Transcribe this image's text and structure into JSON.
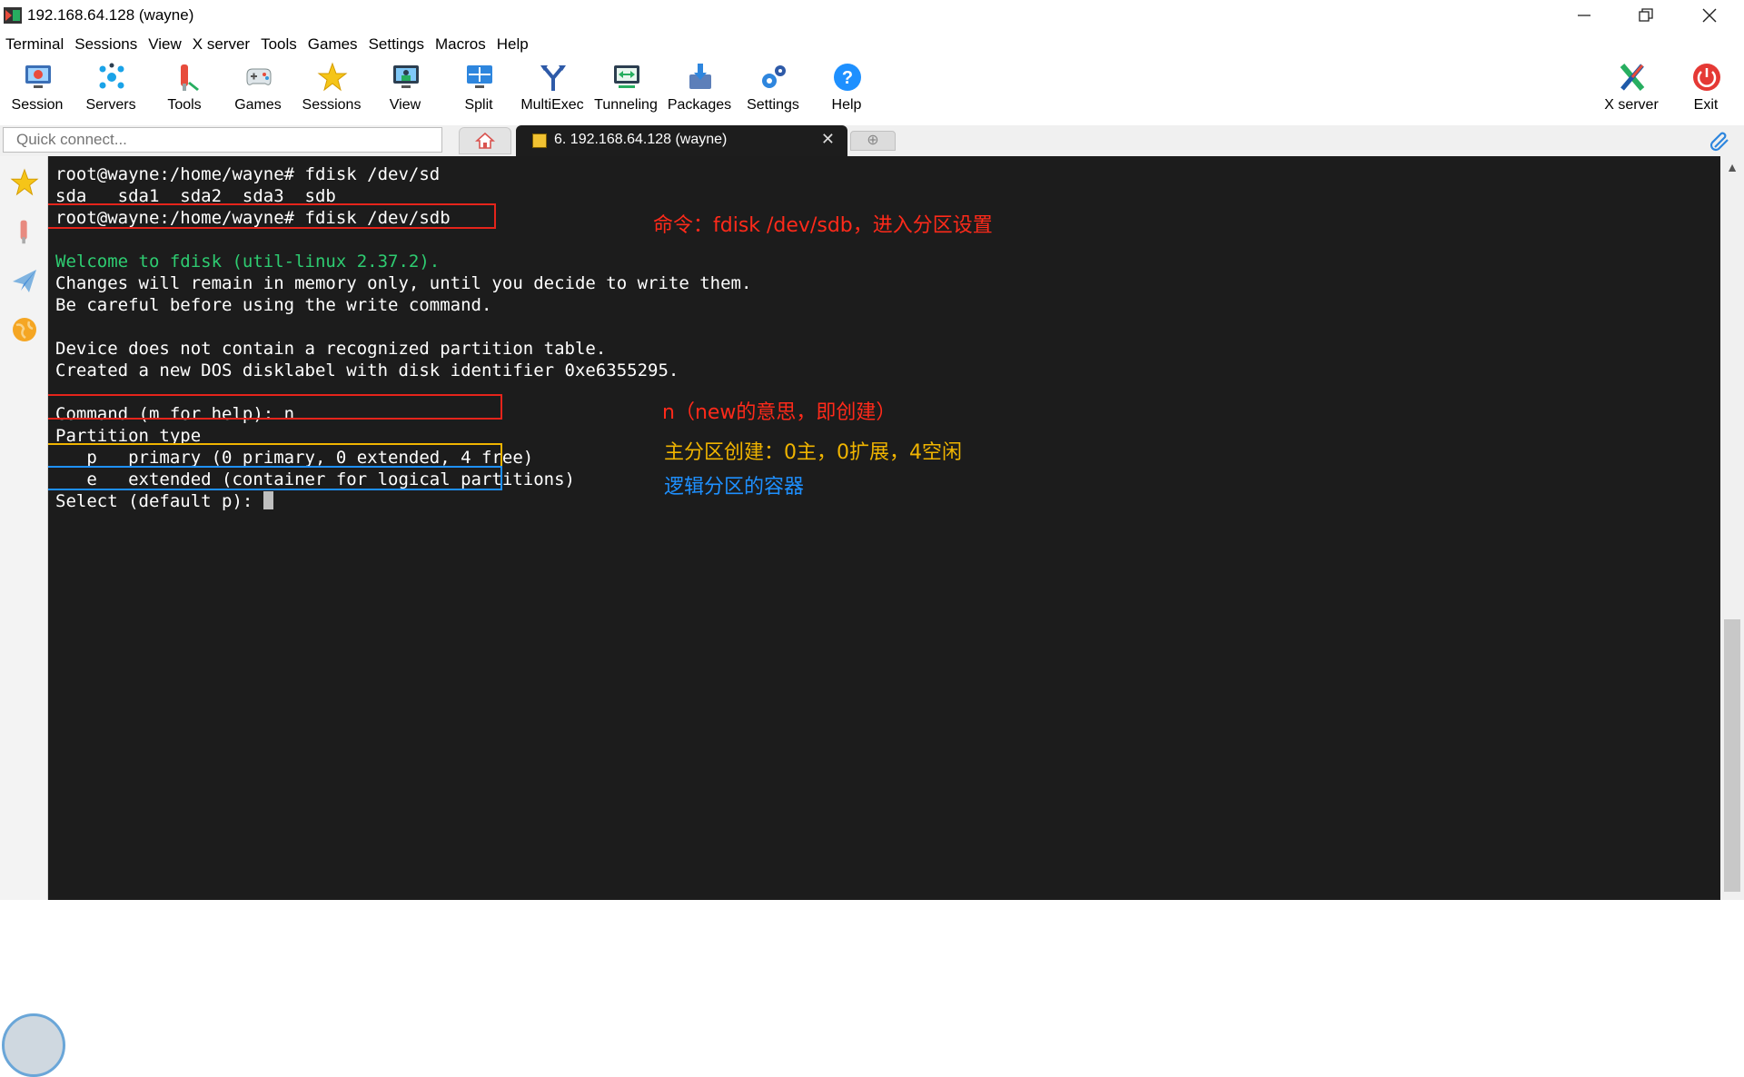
{
  "window": {
    "title": "192.168.64.128 (wayne)",
    "controls": [
      "minimize",
      "restore",
      "close"
    ]
  },
  "menu": [
    "Terminal",
    "Sessions",
    "View",
    "X server",
    "Tools",
    "Games",
    "Settings",
    "Macros",
    "Help"
  ],
  "toolbar": {
    "items": [
      {
        "label": "Session",
        "icon": "session-icon"
      },
      {
        "label": "Servers",
        "icon": "servers-icon"
      },
      {
        "label": "Tools",
        "icon": "tools-icon"
      },
      {
        "label": "Games",
        "icon": "games-icon"
      },
      {
        "label": "Sessions",
        "icon": "star-icon"
      },
      {
        "label": "View",
        "icon": "view-icon"
      },
      {
        "label": "Split",
        "icon": "split-icon"
      },
      {
        "label": "MultiExec",
        "icon": "multiexec-icon"
      },
      {
        "label": "Tunneling",
        "icon": "tunneling-icon"
      },
      {
        "label": "Packages",
        "icon": "packages-icon"
      },
      {
        "label": "Settings",
        "icon": "settings-icon"
      },
      {
        "label": "Help",
        "icon": "help-icon"
      }
    ],
    "right": [
      {
        "label": "X server",
        "icon": "xserver-icon"
      },
      {
        "label": "Exit",
        "icon": "exit-icon"
      }
    ]
  },
  "tabs": {
    "quick_connect_placeholder": "Quick connect...",
    "active_label": "6. 192.168.64.128 (wayne)",
    "close_glyph": "✕",
    "new_tab_glyph": "⊕"
  },
  "terminal": {
    "lines": [
      {
        "text": "root@wayne:/home/wayne# fdisk /dev/sd"
      },
      {
        "text": "sda   sda1  sda2  sda3  sdb"
      },
      {
        "text": "root@wayne:/home/wayne# fdisk /dev/sdb"
      },
      {
        "text": ""
      },
      {
        "text": "Welcome to fdisk (util-linux 2.37.2).",
        "green": true
      },
      {
        "text": "Changes will remain in memory only, until you decide to write them."
      },
      {
        "text": "Be careful before using the write command."
      },
      {
        "text": ""
      },
      {
        "text": "Device does not contain a recognized partition table."
      },
      {
        "text": "Created a new DOS disklabel with disk identifier 0xe6355295."
      },
      {
        "text": ""
      },
      {
        "text": "Command (m for help): n"
      },
      {
        "text": "Partition type"
      },
      {
        "text": "   p   primary (0 primary, 0 extended, 4 free)"
      },
      {
        "text": "   e   extended (container for logical partitions)"
      },
      {
        "text": "Select (default p): ",
        "cursor": true
      }
    ]
  },
  "annotations": [
    {
      "text": "命令：fdisk /dev/sdb，进入分区设置",
      "color": "#ff2a1a"
    },
    {
      "text": "n（new的意思，即创建）",
      "color": "#ff2a1a"
    },
    {
      "text": "主分区创建：0主，0扩展，4空闲",
      "color": "#f0b400"
    },
    {
      "text": "逻辑分区的容器",
      "color": "#1e90ff"
    }
  ],
  "colors": {
    "terminal_bg": "#1c1c1c",
    "box_red": "#e5241b",
    "box_yellow": "#f0b400",
    "box_blue": "#1e90ff",
    "green_text": "#2ecc71"
  }
}
